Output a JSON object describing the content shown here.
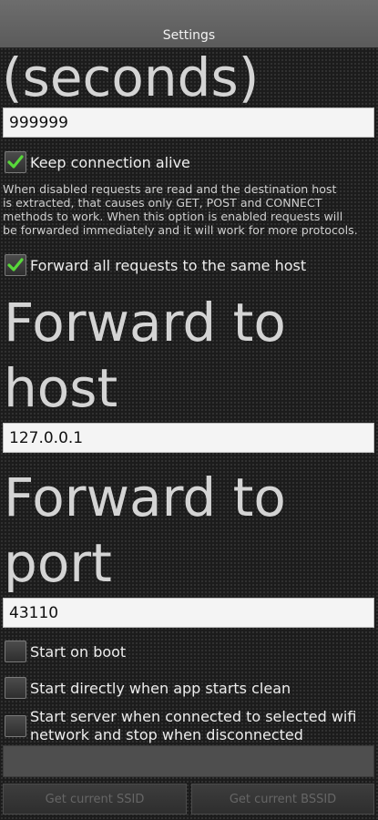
{
  "titlebar": {
    "title": "Settings"
  },
  "timeout": {
    "heading_tail": "(seconds)",
    "value": "999999"
  },
  "keep_alive": {
    "label": "Keep connection alive",
    "checked": true
  },
  "help": {
    "line1": "When disabled requests are read and the destination host",
    "line2": "is extracted, that causes only GET, POST and CONNECT",
    "line3": "methods to work. When this option is enabled requests will",
    "line4": "be forwarded immediately and it will work for more protocols."
  },
  "forward_all": {
    "label": "Forward all requests to the same host",
    "checked": true
  },
  "forward_host": {
    "heading_line1": "Forward to",
    "heading_line2": "host",
    "value": "127.0.0.1"
  },
  "forward_port": {
    "heading_line1": "Forward to",
    "heading_line2": "port",
    "value": "43110"
  },
  "start_on_boot": {
    "label": "Start on boot",
    "checked": false
  },
  "start_directly": {
    "label": "Start directly when app starts clean",
    "checked": false
  },
  "start_wifi": {
    "label_line1": "Start server when connected to selected wifi",
    "label_line2": "network and stop when disconnected",
    "checked": false
  },
  "buttons": {
    "ssid": "Get current SSID",
    "bssid": "Get current BSSID"
  },
  "colors": {
    "check": "#58d83a",
    "background": "#1c1c1c",
    "titlebar": "#636363"
  }
}
